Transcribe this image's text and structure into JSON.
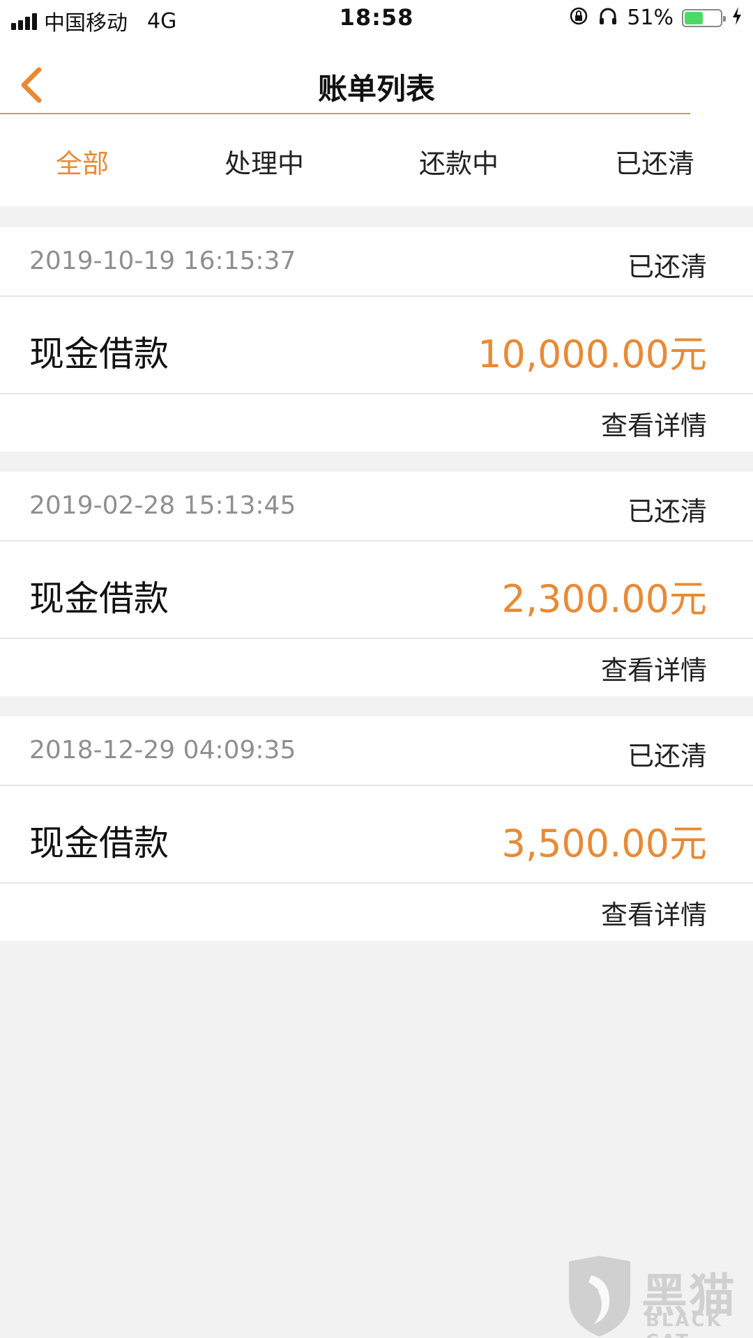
{
  "status_bar": {
    "carrier": "中国移动",
    "network": "4G",
    "time": "18:58",
    "battery_percent": "51%",
    "battery_level": 0.51,
    "icons": [
      "signal-icon",
      "orientation-lock-icon",
      "headphones-icon",
      "battery-icon",
      "charging-icon"
    ]
  },
  "nav": {
    "title": "账单列表",
    "back_icon": "chevron-left-icon"
  },
  "tabs": [
    {
      "label": "全部",
      "active": true
    },
    {
      "label": "处理中",
      "active": false
    },
    {
      "label": "还款中",
      "active": false
    },
    {
      "label": "已还清",
      "active": false
    }
  ],
  "bills": [
    {
      "date": "2019-10-19 16:15:37",
      "status": "已还清",
      "type": "现金借款",
      "amount": "10,000.00元",
      "details": "查看详情"
    },
    {
      "date": "2019-02-28 15:13:45",
      "status": "已还清",
      "type": "现金借款",
      "amount": "2,300.00元",
      "details": "查看详情"
    },
    {
      "date": "2018-12-29 04:09:35",
      "status": "已还清",
      "type": "现金借款",
      "amount": "3,500.00元",
      "details": "查看详情"
    }
  ],
  "watermark": {
    "title": "黑猫",
    "subtitle": "BLACK CAT"
  },
  "colors": {
    "accent": "#e88a35",
    "background": "#f2f2f2",
    "card": "#ffffff",
    "muted_text": "#8f8f8f"
  }
}
